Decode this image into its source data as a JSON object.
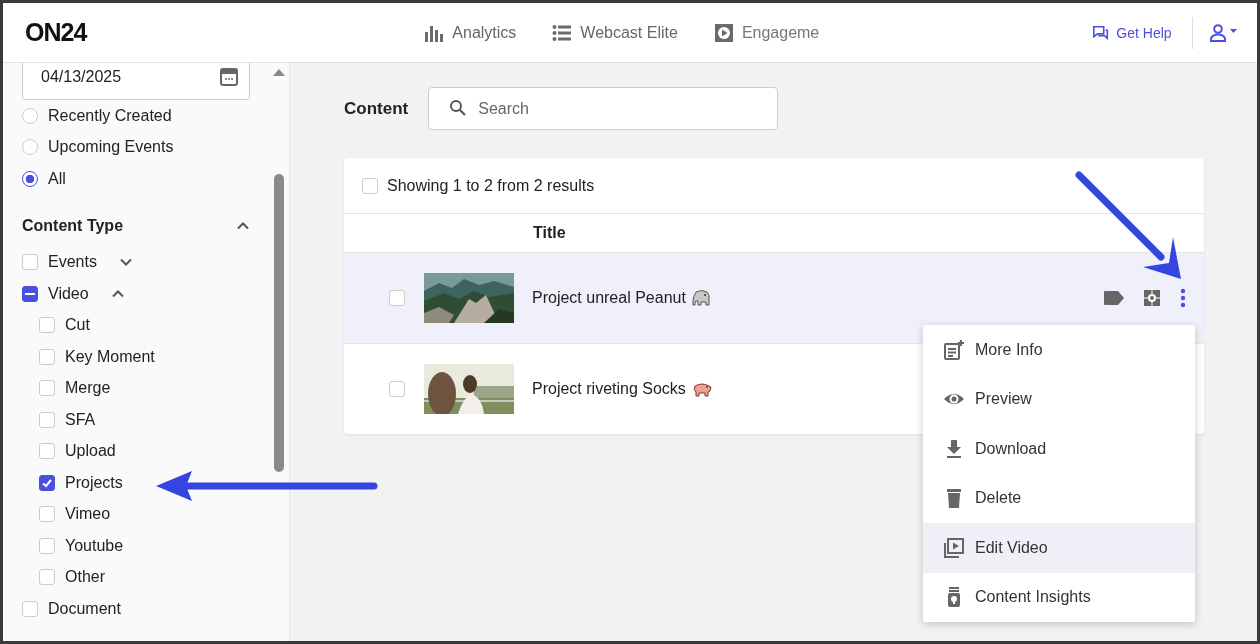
{
  "header": {
    "logo": "ON24",
    "nav": [
      {
        "label": "Analytics"
      },
      {
        "label": "Webcast Elite"
      },
      {
        "label": "Engageme"
      }
    ],
    "help": "Get Help"
  },
  "sidebar": {
    "date": "04/13/2025",
    "filters": [
      {
        "label": "Recently Created",
        "selected": false
      },
      {
        "label": "Upcoming Events",
        "selected": false
      },
      {
        "label": "All",
        "selected": true
      }
    ],
    "section": {
      "title": "Content Type",
      "expanded": true
    },
    "types": [
      {
        "label": "Events",
        "checked": false,
        "indeterminate": false,
        "expanded": false
      },
      {
        "label": "Video",
        "checked": false,
        "indeterminate": true,
        "expanded": true,
        "children": [
          {
            "label": "Cut",
            "checked": false
          },
          {
            "label": "Key Moment",
            "checked": false
          },
          {
            "label": "Merge",
            "checked": false
          },
          {
            "label": "SFA",
            "checked": false
          },
          {
            "label": "Upload",
            "checked": false
          },
          {
            "label": "Projects",
            "checked": true
          },
          {
            "label": "Vimeo",
            "checked": false
          },
          {
            "label": "Youtube",
            "checked": false
          },
          {
            "label": "Other",
            "checked": false
          }
        ]
      },
      {
        "label": "Document",
        "checked": false,
        "indeterminate": false
      }
    ]
  },
  "content": {
    "title": "Content",
    "search": {
      "placeholder": "Search"
    },
    "all_checked": false,
    "summary": "Showing 1 to 2 from 2 results",
    "columns": [
      "Title"
    ],
    "rows": [
      {
        "title": "Project unreal Peanut",
        "selected": true,
        "checked": false
      },
      {
        "title": "Project riveting Socks",
        "selected": false,
        "checked": false
      }
    ]
  },
  "menu": [
    {
      "label": "More Info",
      "selected": false
    },
    {
      "label": "Preview",
      "selected": false
    },
    {
      "label": "Download",
      "selected": false
    },
    {
      "label": "Delete",
      "selected": false
    },
    {
      "label": "Edit Video",
      "selected": true
    },
    {
      "label": "Content Insights",
      "selected": false
    }
  ]
}
